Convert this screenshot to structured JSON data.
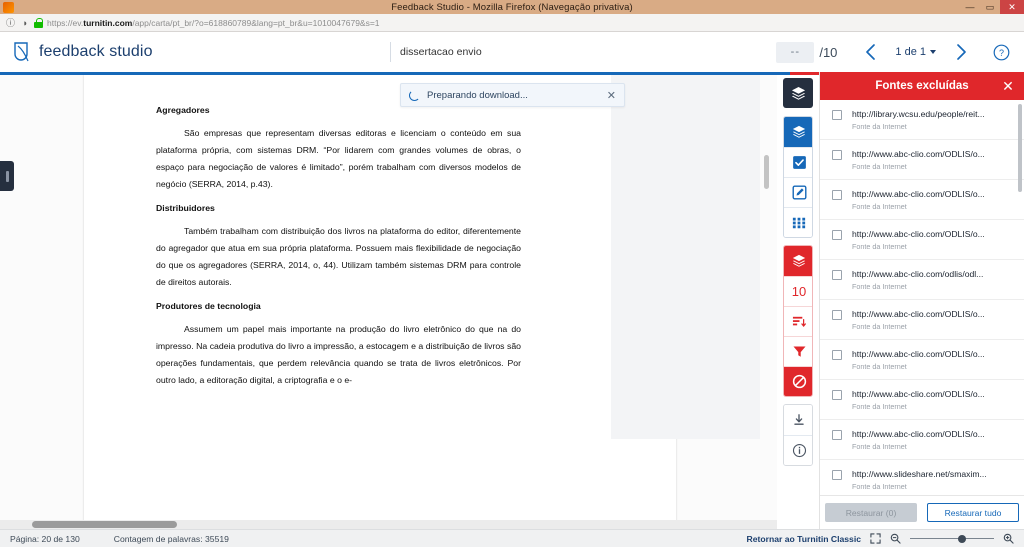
{
  "window": {
    "title": "Feedback Studio - Mozilla Firefox (Navegação privativa)",
    "minimize": "—",
    "maximize": "▭",
    "close": "✕"
  },
  "browser": {
    "url_scheme": "https://ev.",
    "url_domain": "turnitin.com",
    "url_path": "/app/carta/pt_br/?o=618860789&lang=pt_br&u=1010047679&s=1",
    "info_icon": "ⓘ",
    "shield_icon": "◑",
    "lock_icon": "lock"
  },
  "header": {
    "brand": "feedback studio",
    "document_title": "dissertacao envio",
    "grade_value": "--",
    "grade_total": "/10",
    "prev_label": "‹",
    "next_label": "›",
    "pager_label": "1 de 1",
    "help_label": "?"
  },
  "toast": {
    "message": "Preparando download...",
    "close": "✕"
  },
  "document": {
    "blocks": [
      {
        "type": "heading",
        "text": "Agregadores"
      },
      {
        "type": "para",
        "text": "São empresas que representam diversas editoras e licenciam o conteúdo em sua plataforma própria, com sistemas DRM. “Por lidarem com grandes volumes de obras, o espaço para negociação de valores é limitado”, porém trabalham com diversos modelos de negócio (SERRA, 2014, p.43)."
      },
      {
        "type": "heading",
        "text": "Distribuidores"
      },
      {
        "type": "para",
        "text": "Também trabalham com distribuição dos livros na plataforma do editor, diferentemente do agregador que atua em sua própria plataforma. Possuem mais flexibilidade de negociação do que os agregadores (SERRA, 2014, o, 44). Utilizam também sistemas DRM para controle de direitos autorais."
      },
      {
        "type": "heading",
        "text": "Produtores de tecnologia"
      },
      {
        "type": "para",
        "text": "Assumem um papel mais importante na produção do livro eletrônico do que na do impresso. Na cadeia produtiva do livro a impressão, a estocagem e a distribuição de livros são operações fundamentais, que perdem relevância quando se trata de livros eletrônicos. Por outro lado, a editoração digital, a criptografia e o e-"
      }
    ]
  },
  "rail": {
    "items": [
      {
        "name": "layers-active-icon",
        "icon": "layers",
        "style": "dark"
      },
      {
        "name": "layers-blue-icon",
        "icon": "layers",
        "style": "blue"
      },
      {
        "name": "grademark-check-icon",
        "icon": "check-square",
        "style": "outline-blue"
      },
      {
        "name": "feedback-pencil-icon",
        "icon": "pencil-square",
        "style": "outline-blue"
      },
      {
        "name": "rubric-grid-icon",
        "icon": "grid",
        "style": "outline-blue"
      },
      {
        "name": "similarity-layers-icon",
        "icon": "layers",
        "style": "redfill"
      },
      {
        "name": "similarity-score-value",
        "icon": "text",
        "style": "count",
        "label": "10"
      },
      {
        "name": "match-overview-icon",
        "icon": "match-list",
        "style": "outline-red"
      },
      {
        "name": "filters-funnel-icon",
        "icon": "funnel",
        "style": "outline-red"
      },
      {
        "name": "excluded-sources-icon",
        "icon": "no-entry",
        "style": "redfill-active"
      },
      {
        "name": "download-icon",
        "icon": "download",
        "style": "outline-gray"
      },
      {
        "name": "info-icon",
        "icon": "info-circle",
        "style": "outline-gray"
      }
    ]
  },
  "panel": {
    "title": "Fontes excluídas",
    "close": "✕",
    "source_type_label": "Fonte da Internet",
    "sources": [
      {
        "url": "http://library.wcsu.edu/people/reit...",
        "type": "Fonte da Internet"
      },
      {
        "url": "http://www.abc-clio.com/ODLIS/o...",
        "type": "Fonte da Internet"
      },
      {
        "url": "http://www.abc-clio.com/ODLIS/o...",
        "type": "Fonte da Internet"
      },
      {
        "url": "http://www.abc-clio.com/ODLIS/o...",
        "type": "Fonte da Internet"
      },
      {
        "url": "http://www.abc-clio.com/odlis/odl...",
        "type": "Fonte da Internet"
      },
      {
        "url": "http://www.abc-clio.com/ODLIS/o...",
        "type": "Fonte da Internet"
      },
      {
        "url": "http://www.abc-clio.com/ODLIS/o...",
        "type": "Fonte da Internet"
      },
      {
        "url": "http://www.abc-clio.com/ODLIS/o...",
        "type": "Fonte da Internet"
      },
      {
        "url": "http://www.abc-clio.com/ODLIS/o...",
        "type": "Fonte da Internet"
      },
      {
        "url": "http://www.slideshare.net/smaxim...",
        "type": "Fonte da Internet"
      }
    ],
    "restore_label": "Restaurar (0)",
    "restore_all_label": "Restaurar tudo"
  },
  "status": {
    "page": "Página: 20 de 130",
    "word_count": "Contagem de palavras: 35519",
    "classic_link": "Retornar ao Turnitin Classic",
    "fullscreen_icon": "⤢",
    "zoom_out_icon": "−",
    "zoom_in_icon": "+"
  },
  "colors": {
    "brand_blue": "#1668b8",
    "dark_navy": "#252f3f",
    "red": "#e0272b",
    "title_bar": "#d9ab85"
  }
}
